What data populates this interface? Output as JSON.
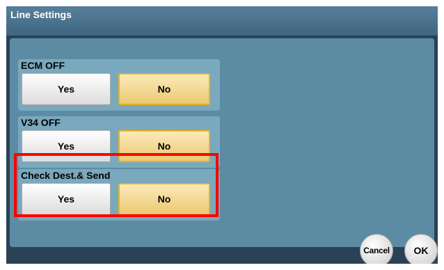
{
  "title": "Line Settings",
  "settings": [
    {
      "label": "ECM OFF",
      "yes": "Yes",
      "no": "No",
      "selected": "No"
    },
    {
      "label": "V34 OFF",
      "yes": "Yes",
      "no": "No",
      "selected": "No"
    },
    {
      "label": "Check Dest.& Send",
      "yes": "Yes",
      "no": "No",
      "selected": "No"
    }
  ],
  "footer": {
    "cancel_label": "Cancel",
    "ok_label": "OK"
  },
  "colors": {
    "selection_highlight": "#ff0000",
    "selected_button": "#f2d27e",
    "panel_background": "#5c8ca3"
  }
}
